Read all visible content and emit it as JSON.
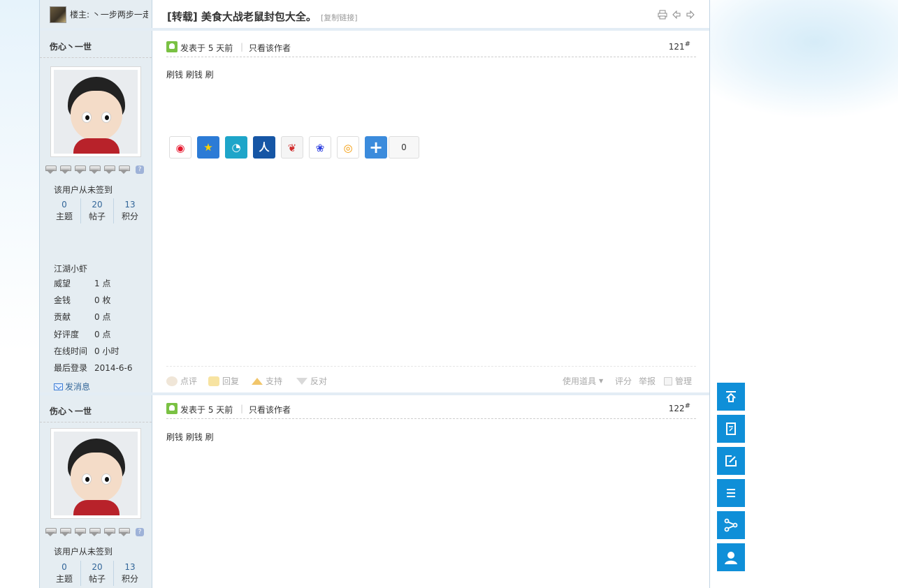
{
  "topbar": {
    "host_label": "楼主:",
    "host_name": "丶一步两步一走",
    "thread_title": "[转载] 美食大战老鼠封包大全。",
    "copy_link": "[复制链接]",
    "print_icon": "print-icon",
    "prev_icon": "prev-thread-icon",
    "next_icon": "next-thread-icon"
  },
  "posts": [
    {
      "username": "伤心丶一世",
      "sign_status": "该用户从未签到",
      "stats": [
        {
          "num": "0",
          "label": "主题"
        },
        {
          "num": "20",
          "label": "帖子"
        },
        {
          "num": "13",
          "label": "积分"
        }
      ],
      "rank": "江湖小虾",
      "info": [
        {
          "k": "威望",
          "v": "1 点"
        },
        {
          "k": "金钱",
          "v": "0 枚"
        },
        {
          "k": "贡献",
          "v": "0 点"
        },
        {
          "k": "好评度",
          "v": "0 点"
        },
        {
          "k": "在线时间",
          "v": "0 小时"
        },
        {
          "k": "最后登录",
          "v": "2014-6-6"
        }
      ],
      "pm": "发消息",
      "posted": "发表于 5 天前",
      "only_author": "只看该作者",
      "floor": "121",
      "body": "刷钱 刷钱 刷",
      "share_count": "0",
      "actions": {
        "rate": "点评",
        "reply": "回复",
        "support": "支持",
        "oppose": "反对",
        "tools": "使用道具",
        "score": "评分",
        "report": "举报",
        "manage": "管理"
      }
    },
    {
      "username": "伤心丶一世",
      "sign_status": "该用户从未签到",
      "stats": [
        {
          "num": "0",
          "label": "主题"
        },
        {
          "num": "20",
          "label": "帖子"
        },
        {
          "num": "13",
          "label": "积分"
        }
      ],
      "posted": "发表于 5 天前",
      "only_author": "只看该作者",
      "floor": "122",
      "body": "刷钱 刷钱 刷"
    }
  ],
  "share_icons": [
    "weibo-icon",
    "qzone-icon",
    "tencent-weibo-icon",
    "renren-icon",
    "kaixin-icon",
    "baidu-icon",
    "qq-icon",
    "more-share-icon"
  ],
  "float_toolbar": [
    "back-to-top-icon",
    "quick-reply-icon",
    "new-post-icon",
    "list-icon",
    "share-icon",
    "user-center-icon"
  ],
  "colors": {
    "accent": "#0f8fd8",
    "link": "#336699",
    "sidebar": "#e5edf2",
    "border": "#c2d5e3"
  }
}
